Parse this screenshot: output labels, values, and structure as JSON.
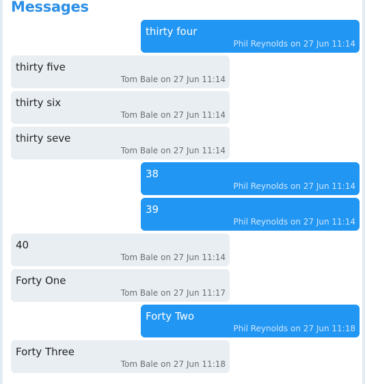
{
  "header": {
    "title": "Messages"
  },
  "messages": [
    {
      "text": "thirty four",
      "author": "Phil Reynolds",
      "sep": "on",
      "time": "27 Jun 11:14",
      "direction": "sent"
    },
    {
      "text": "thirty five",
      "author": "Tom Bale",
      "sep": "on",
      "time": "27 Jun 11:14",
      "direction": "received"
    },
    {
      "text": "thirty six",
      "author": "Tom Bale",
      "sep": "on",
      "time": "27 Jun 11:14",
      "direction": "received"
    },
    {
      "text": "thirty seve",
      "author": "Tom Bale",
      "sep": "on",
      "time": "27 Jun 11:14",
      "direction": "received"
    },
    {
      "text": "38",
      "author": "Phil Reynolds",
      "sep": "on",
      "time": "27 Jun 11:14",
      "direction": "sent"
    },
    {
      "text": "39",
      "author": "Phil Reynolds",
      "sep": "on",
      "time": "27 Jun 11:14",
      "direction": "sent"
    },
    {
      "text": "40",
      "author": "Tom Bale",
      "sep": "on",
      "time": "27 Jun 11:14",
      "direction": "received"
    },
    {
      "text": "Forty One",
      "author": "Tom Bale",
      "sep": "on",
      "time": "27 Jun 11:17",
      "direction": "received"
    },
    {
      "text": "Forty Two",
      "author": "Phil Reynolds",
      "sep": "on",
      "time": "27 Jun 11:18",
      "direction": "sent"
    },
    {
      "text": "Forty Three",
      "author": "Tom Bale",
      "sep": "on",
      "time": "27 Jun 11:18",
      "direction": "received"
    }
  ],
  "colors": {
    "accent": "#2b8fe6",
    "sent_bubble": "#2196f3",
    "received_bubble": "#e9eef3"
  }
}
